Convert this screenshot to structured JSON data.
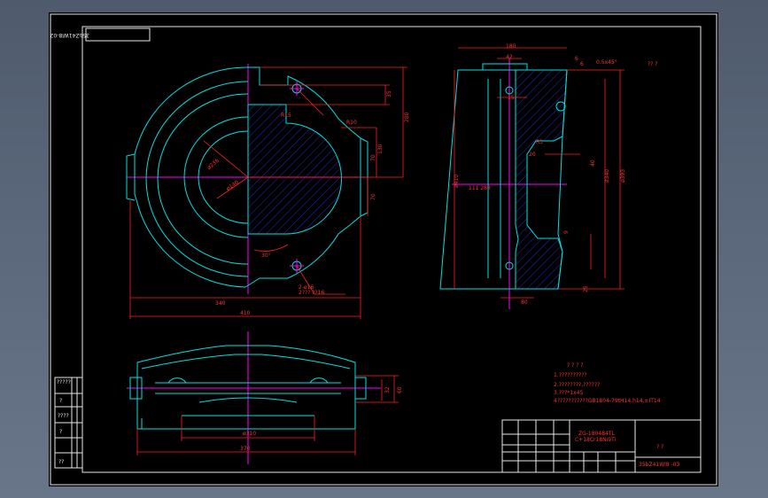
{
  "drawing": {
    "code_rotated": "35bZ41Wl8-02",
    "title_code": "35bZ41Wl8 -03",
    "tech_heading": "? ? ? ?",
    "notes": [
      "1.??????????",
      "2.????????,??????",
      "3.???*1x45",
      "4???????????GB1804-79tH14,h14,±IT14"
    ],
    "material_line1": "ZG-180484TL",
    "material_line2": "C+18Cr18Ni9Ti",
    "roughness_note": "?? ?",
    "title_marks": "? ?",
    "top_view_dims": {
      "d35": "35",
      "d130": "130",
      "d280": "280",
      "d70a": "70",
      "d70b": "70",
      "d340": "340",
      "d410": "410",
      "r15": "R15",
      "r10": "R10",
      "dia236": "ø236",
      "dia140": "ø140",
      "ang30": "30°",
      "holes": "2-ø16",
      "holes2": "2??? ??16"
    },
    "section_dims": {
      "d180": "180",
      "d42": "42",
      "d6a": "6",
      "d6b": "6",
      "d15": "15",
      "chamfer": "0.5x45°",
      "r3": "R3",
      "d20": "20",
      "d40": "40",
      "d9": "9",
      "dia410": "ø410",
      "dia340": "ø340",
      "dia393": "ø393",
      "m111": "111 283",
      "d80": "80",
      "d25": "25"
    },
    "front_dims": {
      "dia310": "ø310",
      "d370": "370",
      "d32": "32",
      "d60": "60"
    },
    "left_strip_labels": [
      "?????",
      "?",
      "????",
      "?",
      "??"
    ]
  }
}
